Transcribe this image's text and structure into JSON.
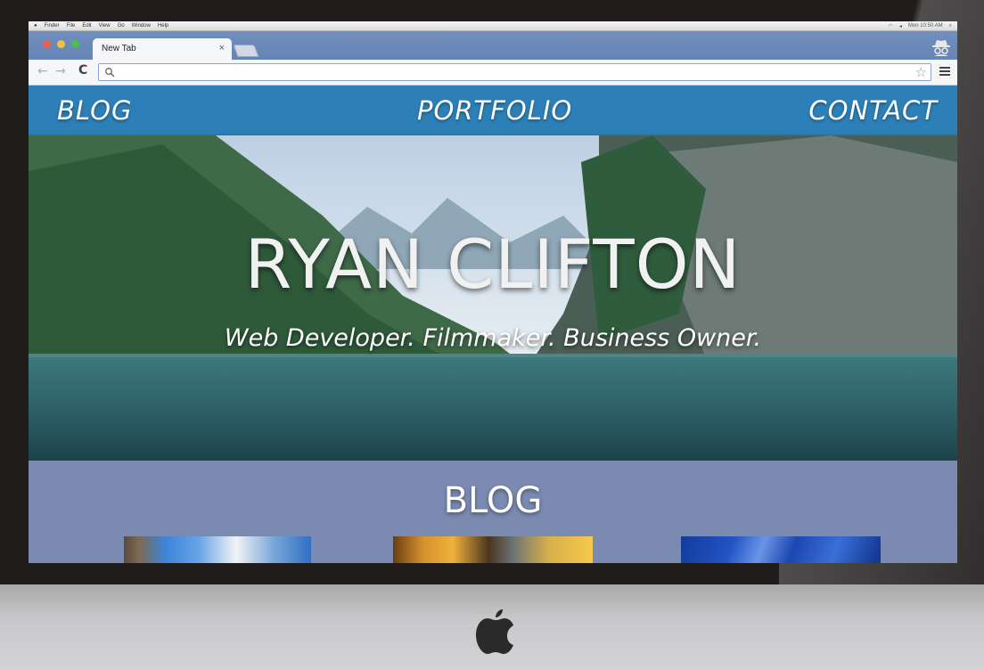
{
  "os_menubar": {
    "items": [
      "Finder",
      "File",
      "Edit",
      "View",
      "Go",
      "Window",
      "Help"
    ],
    "clock": "Mon 10:50 AM"
  },
  "browser": {
    "tab_title": "New Tab",
    "tab_close": "×",
    "address_value": "",
    "address_placeholder": ""
  },
  "site": {
    "nav": {
      "blog": "BLOG",
      "portfolio": "PORTFOLIO",
      "contact": "CONTACT"
    },
    "hero": {
      "title": "RYAN CLIFTON",
      "subtitle": "Web Developer. Filmmaker. Business Owner."
    },
    "blog": {
      "heading": "BLOG"
    }
  },
  "colors": {
    "nav_bar": "#2d80b7",
    "blog_section": "#7a8ab1",
    "tab_strip": "#6f8fbf"
  },
  "icons": [
    "apple-icon",
    "search-icon",
    "bookmark-star-icon",
    "chrome-menu-icon",
    "incognito-icon",
    "back-arrow-icon",
    "forward-arrow-icon",
    "reload-icon"
  ]
}
